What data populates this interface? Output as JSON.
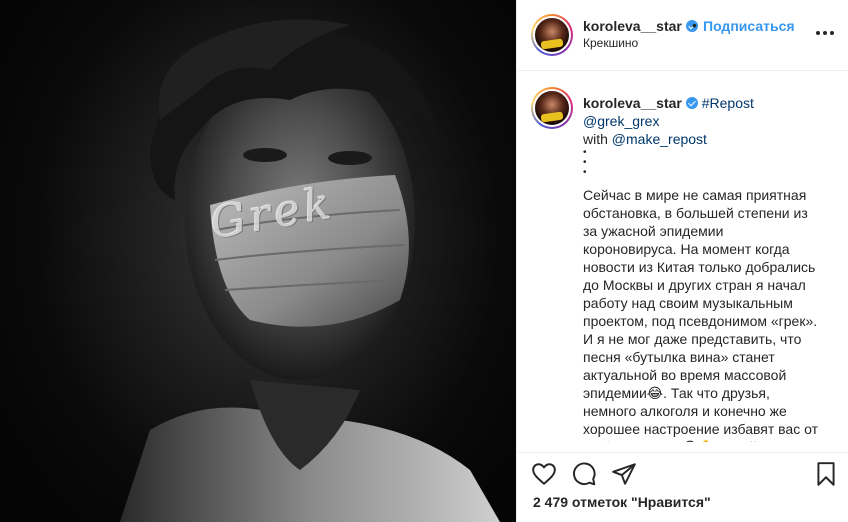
{
  "post": {
    "watermark": "Grek"
  },
  "header": {
    "username": "koroleva__star",
    "dot": "•",
    "follow_label": "Подписаться",
    "location": "Крекшино"
  },
  "caption": {
    "username": "koroleva__star",
    "tag": "#Repost @grek_grex",
    "with_prefix": "with ",
    "with_handle": "@make_repost",
    "dots": "•\n•\n•",
    "body": "Сейчас в мире не самая приятная обстановка, в большей степени из за ужасной эпидемии короновируса. На момент когда новости из Китая только добрались до Москвы и других стран я начал работу над своим музыкальным проектом, под псевдонимом «грек». И я не мог даже представить, что песня «бутылка вина» станет актуальной во время массовой эпидемии😂. Так что друзья, немного алкоголя и конечно же хорошее настроение избавят вас от любых вирусов😆💪 Качайте песню и защищайтесь от короновируса! 🧼\nСсылка в шапке профиля👆👆👆"
  },
  "likes": {
    "text": "2 479 отметок \"Нравится\""
  },
  "icons": {
    "like": "heart-icon",
    "comment": "comment-icon",
    "share": "share-icon",
    "save": "bookmark-icon",
    "more": "more-icon",
    "verified": "verified-badge-icon"
  },
  "colors": {
    "link": "#3897f0",
    "text": "#262626",
    "border": "#efefef"
  }
}
